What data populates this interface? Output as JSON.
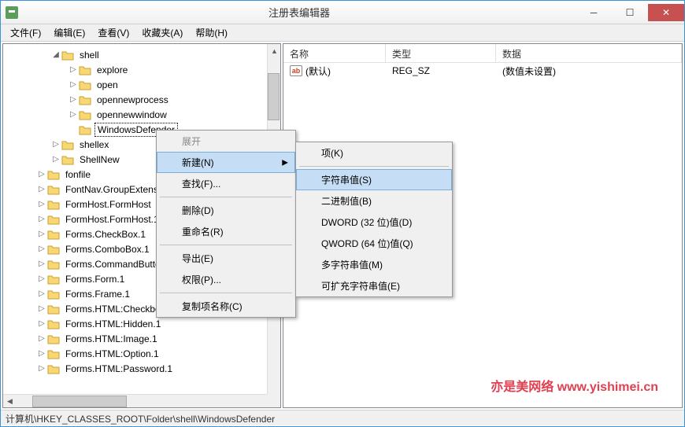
{
  "title": "注册表编辑器",
  "menus": {
    "file": "文件(F)",
    "edit": "编辑(E)",
    "view": "查看(V)",
    "favorites": "收藏夹(A)",
    "help": "帮助(H)"
  },
  "tree": {
    "shell": "shell",
    "explore": "explore",
    "open": "open",
    "opennewprocess": "opennewprocess",
    "opennewwindow": "opennewwindow",
    "windowsdefender": "WindowsDefender",
    "shellex": "shellex",
    "shellnew": "ShellNew",
    "fonfile": "fonfile",
    "fontnav": "FontNav.GroupExtension",
    "formhost1": "FormHost.FormHost",
    "formhost2": "FormHost.FormHost.1",
    "checkbox": "Forms.CheckBox.1",
    "combobox": "Forms.ComboBox.1",
    "commandb": "Forms.CommandButton.1",
    "form": "Forms.Form.1",
    "frame": "Forms.Frame.1",
    "htmlcheckbox": "Forms.HTML:Checkbox.1",
    "htmlhidden": "Forms.HTML:Hidden.1",
    "htmlimage": "Forms.HTML:Image.1",
    "htmloption": "Forms.HTML:Option.1",
    "htmlpassword": "Forms.HTML:Password.1"
  },
  "list": {
    "headers": {
      "name": "名称",
      "type": "类型",
      "data": "数据"
    },
    "default_name": "(默认)",
    "default_type": "REG_SZ",
    "default_data": "(数值未设置)"
  },
  "context": {
    "expand": "展开",
    "new": "新建(N)",
    "find": "查找(F)...",
    "delete": "删除(D)",
    "rename": "重命名(R)",
    "export": "导出(E)",
    "permissions": "权限(P)...",
    "copykey": "复制项名称(C)"
  },
  "submenu": {
    "key": "项(K)",
    "string": "字符串值(S)",
    "binary": "二进制值(B)",
    "dword": "DWORD (32 位)值(D)",
    "qword": "QWORD (64 位)值(Q)",
    "multistring": "多字符串值(M)",
    "expandable": "可扩充字符串值(E)"
  },
  "statusbar": "计算机\\HKEY_CLASSES_ROOT\\Folder\\shell\\WindowsDefender",
  "watermark": "亦是美网络 www.yishimei.cn"
}
